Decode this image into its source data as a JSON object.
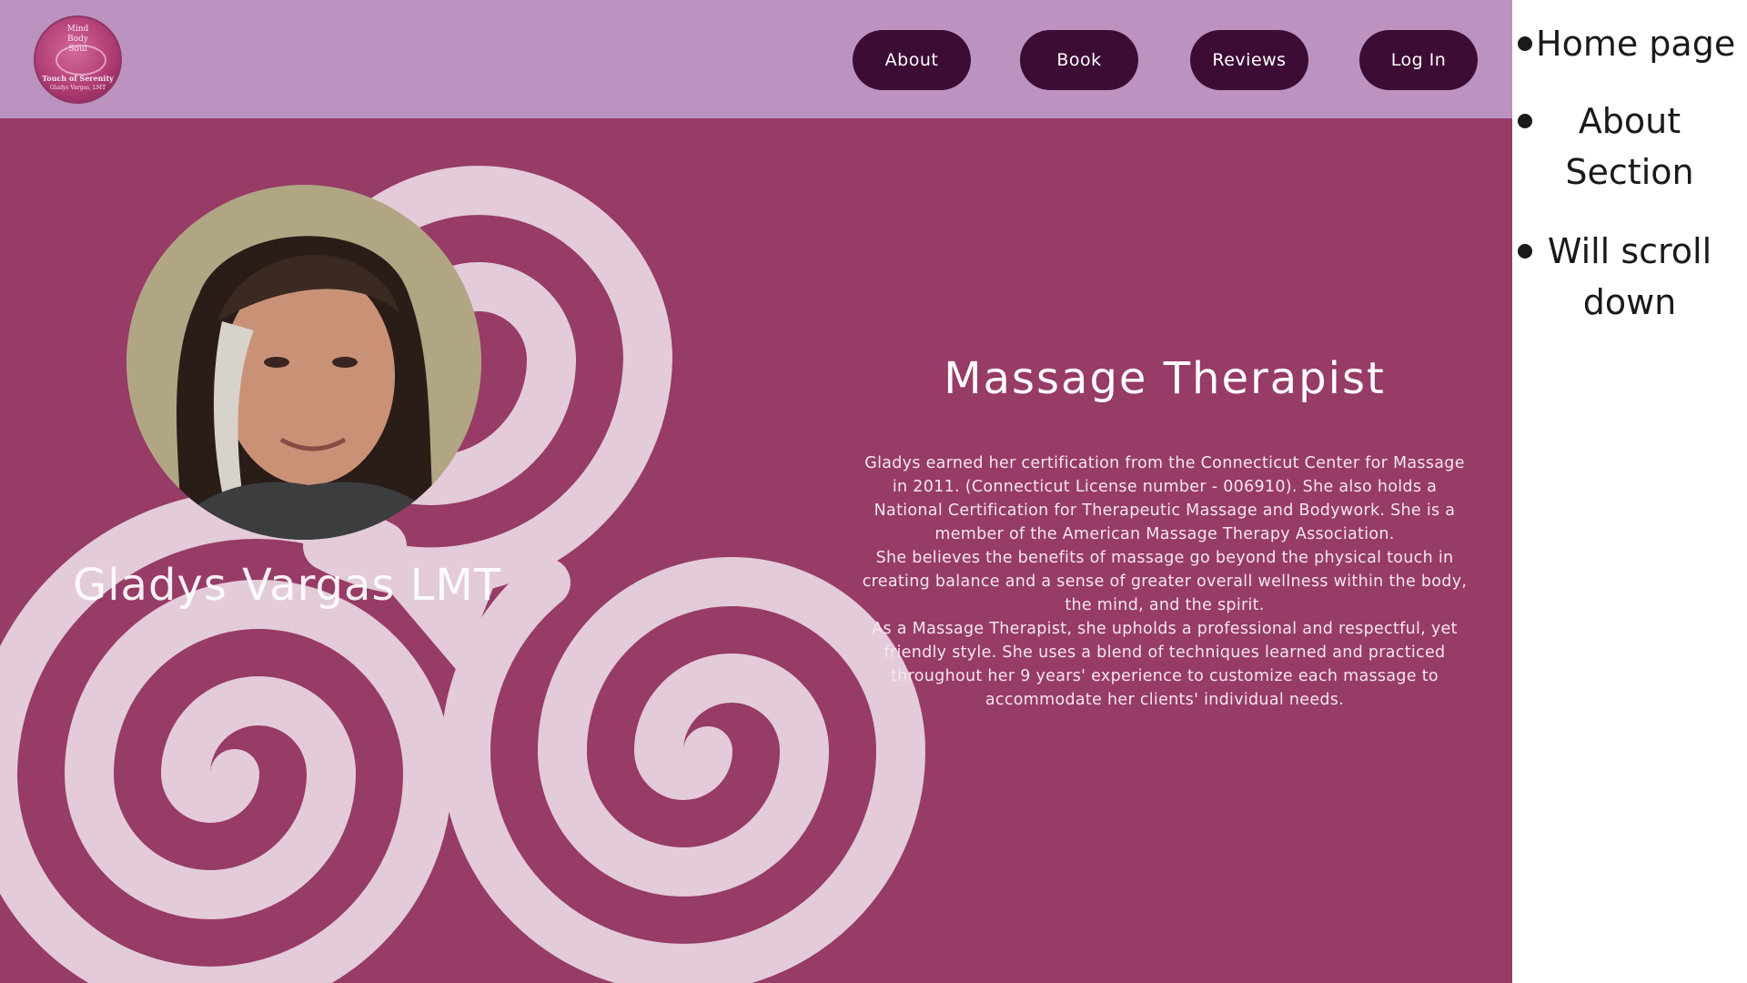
{
  "brand": {
    "logo_lines": [
      "Mind",
      "Body",
      "Soul"
    ],
    "logo_name": "Touch of Serenity",
    "logo_sub": "Gladys Vargas, LMT"
  },
  "nav": {
    "about": "About",
    "book": "Book",
    "reviews": "Reviews",
    "login": "Log In"
  },
  "about": {
    "name": "Gladys Vargas LMT",
    "title": "Massage Therapist",
    "paragraphs": [
      "Gladys earned her certification from the Connecticut Center for Massage in 2011. (Connecticut License number - 006910). She also holds a National Certification for Therapeutic Massage and Bodywork. She is a member of the American Massage Therapy Association.",
      "She believes the benefits of massage go beyond the physical touch in creating balance and a sense of greater overall wellness within the body, the mind, and the spirit.",
      "As a Massage Therapist, she upholds a professional and respectful, yet friendly style. She uses a blend of techniques learned and practiced throughout her 9 years' experience to customize each massage to accommodate her clients' individual needs."
    ]
  },
  "notes": {
    "n1": "Home page",
    "n2": "About Section",
    "n3": "Will scroll down"
  },
  "colors": {
    "nav_bg": "#bb92c0",
    "page_bg": "#973b67",
    "button_bg": "#3c0c34",
    "spiral": "#e3cbd9"
  }
}
